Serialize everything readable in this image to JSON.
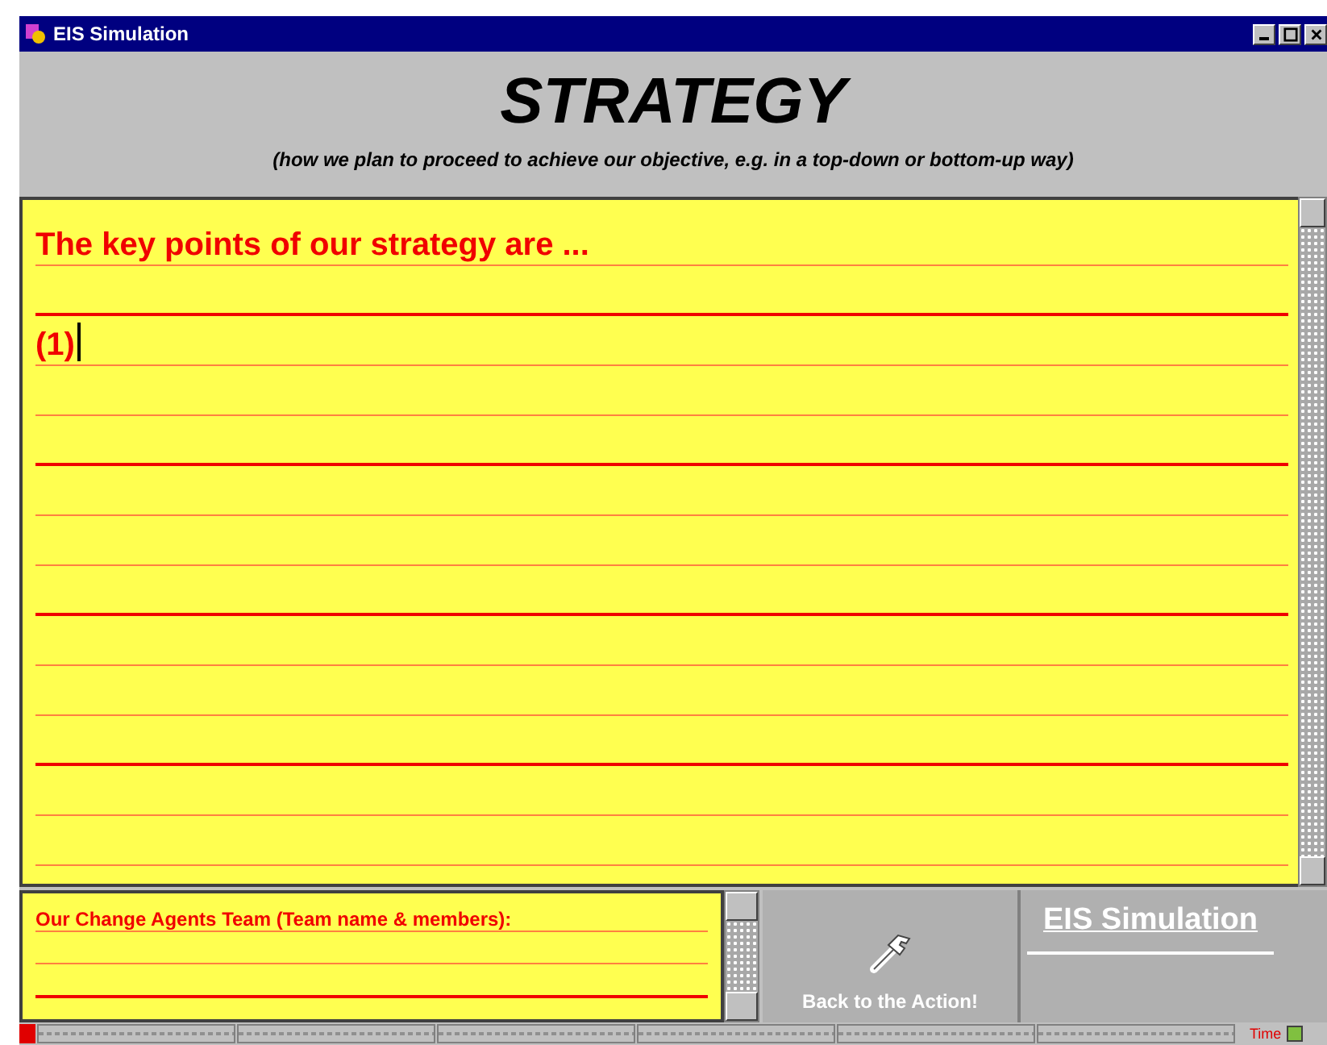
{
  "window": {
    "title": "EIS Simulation"
  },
  "header": {
    "title": "STRATEGY",
    "subtitle": "(how we plan to proceed to achieve our objective, e.g. in a top-down or bottom-up way)"
  },
  "strategy": {
    "heading": "The key points of our strategy are ...",
    "entries": [
      "(1)"
    ]
  },
  "team": {
    "label": "Our Change Agents Team (Team name & members):"
  },
  "back_button": {
    "label": "Back to the Action!"
  },
  "logo": {
    "text": "EIS Simulation"
  },
  "status_bar": {
    "time_label": "Time"
  }
}
